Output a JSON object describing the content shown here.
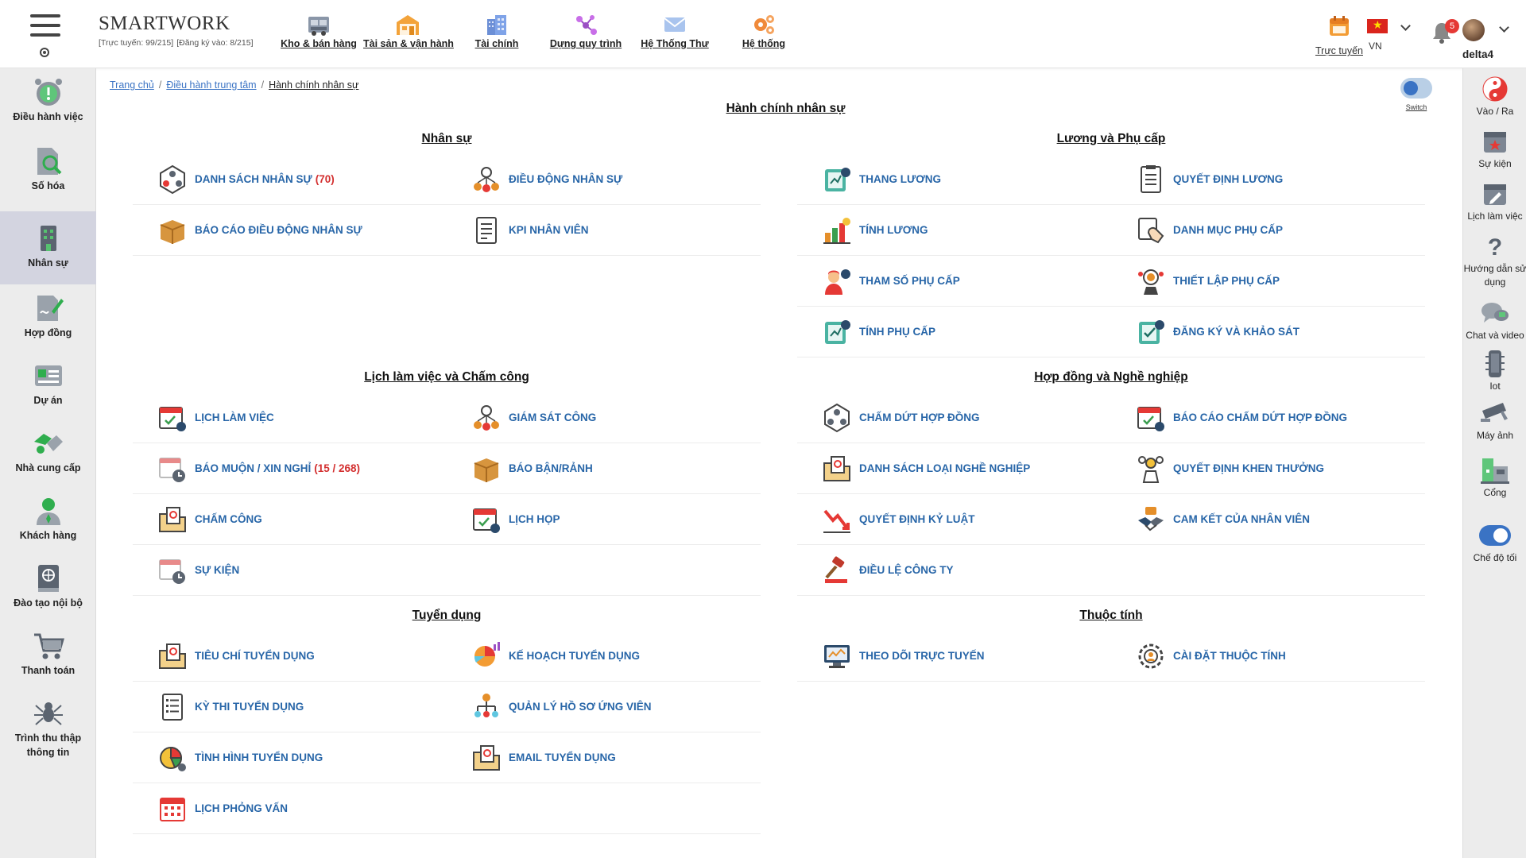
{
  "app": {
    "name": "SMARTWORK",
    "online_stats": "[Trực tuyến: 99/215]",
    "registered_stats": "[Đăng ký vào: 8/215]"
  },
  "top_nav": [
    {
      "label": "Kho & bán hàng",
      "icon": "warehouse-truck-icon"
    },
    {
      "label": "Tài sản & vận hành",
      "icon": "building-store-icon"
    },
    {
      "label": "Tài chính",
      "icon": "city-buildings-icon"
    },
    {
      "label": "Dựng quy trình",
      "icon": "workflow-nodes-icon"
    },
    {
      "label": "Hệ Thống Thư",
      "icon": "envelope-icon"
    },
    {
      "label": "Hệ thống",
      "icon": "gears-icon"
    }
  ],
  "top_right": {
    "online_label": "Trực tuyến",
    "language": "VN",
    "notification_count": "5",
    "username": "delta4"
  },
  "left_sidebar": [
    {
      "label": "Điều hành việc",
      "icon": "alarm-clock-icon"
    },
    {
      "label": "Số hóa",
      "icon": "document-search-icon"
    },
    {
      "label": "Nhân sự",
      "icon": "office-building-icon",
      "active": true
    },
    {
      "label": "Hợp đồng",
      "icon": "contract-pen-icon"
    },
    {
      "label": "Dự án",
      "icon": "project-card-icon"
    },
    {
      "label": "Nhà cung cấp",
      "icon": "supplier-handshake-icon"
    },
    {
      "label": "Khách hàng",
      "icon": "customer-person-icon"
    },
    {
      "label": "Đào tạo nội bộ",
      "icon": "training-book-icon"
    },
    {
      "label": "Thanh toán",
      "icon": "shopping-cart-icon"
    },
    {
      "label": "Trình thu thập thông tin",
      "icon": "crawler-spider-icon"
    }
  ],
  "right_sidebar": [
    {
      "label": "Vào / Ra",
      "icon": "yin-yang-icon"
    },
    {
      "label": "Sự kiện",
      "icon": "event-calendar-icon"
    },
    {
      "label": "Lịch làm việc",
      "icon": "work-calendar-icon"
    },
    {
      "label": "Hướng dẫn sử dụng",
      "icon": "help-question-icon"
    },
    {
      "label": "Chat và video",
      "icon": "chat-bubbles-icon"
    },
    {
      "label": "Iot",
      "icon": "iot-device-icon"
    },
    {
      "label": "Máy ảnh",
      "icon": "security-camera-icon"
    },
    {
      "label": "Cổng",
      "icon": "gate-door-icon"
    },
    {
      "label": "Chế độ tối",
      "icon": "toggle-icon"
    }
  ],
  "breadcrumb": {
    "home": "Trang chủ",
    "parent": "Điều hành trung tâm",
    "current": "Hành chính nhân sự"
  },
  "switch_label": "Switch",
  "page_title": "Hành chính nhân sự",
  "sections": [
    {
      "title": "Nhân sự",
      "items": [
        {
          "label": "DANH SÁCH NHÂN SỰ",
          "count": "(70)",
          "icon": "people-network-icon"
        },
        {
          "label": "ĐIỀU ĐỘNG NHÂN SỰ",
          "count": "",
          "icon": "team-transfer-icon"
        },
        {
          "label": "BÁO CÁO ĐIỀU ĐỘNG NHÂN SỰ",
          "count": "",
          "icon": "box-report-icon"
        },
        {
          "label": "KPI NHÂN VIÊN",
          "count": "",
          "icon": "kpi-document-icon"
        }
      ]
    },
    {
      "title": "Lương và Phụ cấp",
      "items": [
        {
          "label": "THANG LƯƠNG",
          "count": "",
          "icon": "salary-scale-icon"
        },
        {
          "label": "QUYẾT ĐỊNH LƯƠNG",
          "count": "",
          "icon": "decision-document-icon"
        },
        {
          "label": "TÍNH LƯƠNG",
          "count": "",
          "icon": "salary-chart-icon"
        },
        {
          "label": "DANH MỤC PHỤ CẤP",
          "count": "",
          "icon": "allowance-catalog-icon"
        },
        {
          "label": "THAM SỐ PHỤ CẤP",
          "count": "",
          "icon": "allowance-parameter-icon"
        },
        {
          "label": "THIẾT LẬP PHỤ CẤP",
          "count": "",
          "icon": "allowance-setup-icon"
        },
        {
          "label": "TÍNH PHỤ CẤP",
          "count": "",
          "icon": "allowance-calc-icon"
        },
        {
          "label": "ĐĂNG KÝ VÀ KHẢO SÁT",
          "count": "",
          "icon": "survey-register-icon"
        }
      ]
    },
    {
      "title": "Lịch làm việc và Chấm công",
      "items": [
        {
          "label": "LỊCH LÀM VIỆC",
          "count": "",
          "icon": "work-schedule-icon"
        },
        {
          "label": "GIÁM SÁT CÔNG",
          "count": "",
          "icon": "work-monitor-icon"
        },
        {
          "label": "BÁO MUỘN / XIN NGHỈ",
          "count": "(15 / 268)",
          "icon": "late-leave-calendar-icon"
        },
        {
          "label": "BÁO BẬN/RẢNH",
          "count": "",
          "icon": "busy-free-box-icon"
        },
        {
          "label": "CHẤM CÔNG",
          "count": "",
          "icon": "timekeeping-folder-icon"
        },
        {
          "label": "LỊCH HỌP",
          "count": "",
          "icon": "meeting-calendar-icon"
        },
        {
          "label": "SỰ KIỆN",
          "count": "",
          "icon": "event-clock-icon"
        }
      ]
    },
    {
      "title": "Hợp đồng và Nghề nghiệp",
      "items": [
        {
          "label": "CHẤM DỨT HỢP ĐỒNG",
          "count": "",
          "icon": "contract-terminate-icon"
        },
        {
          "label": "BÁO CÁO CHẤM DỨT HỢP ĐỒNG",
          "count": "",
          "icon": "termination-report-icon"
        },
        {
          "label": "DANH SÁCH LOẠI NGHỀ NGHIỆP",
          "count": "",
          "icon": "occupation-folder-icon"
        },
        {
          "label": "QUYẾT ĐỊNH KHEN THƯỞNG",
          "count": "",
          "icon": "reward-decision-icon"
        },
        {
          "label": "QUYẾT ĐỊNH KỶ LUẬT",
          "count": "",
          "icon": "discipline-chart-icon"
        },
        {
          "label": "CAM KẾT CỦA NHÂN VIÊN",
          "count": "",
          "icon": "commitment-handshake-icon"
        },
        {
          "label": "ĐIỀU LỆ CÔNG TY",
          "count": "",
          "icon": "gavel-icon"
        }
      ]
    },
    {
      "title": "Tuyển dụng",
      "items": [
        {
          "label": "TIÊU CHÍ TUYỂN DỤNG",
          "count": "",
          "icon": "criteria-folder-icon"
        },
        {
          "label": "KẾ HOẠCH TUYỂN DỤNG",
          "count": "",
          "icon": "plan-pie-chart-icon"
        },
        {
          "label": "KỲ THI TUYỂN DỤNG",
          "count": "",
          "icon": "exam-list-icon"
        },
        {
          "label": "QUẢN LÝ HỒ SƠ ỨNG VIÊN",
          "count": "",
          "icon": "candidate-tree-icon"
        },
        {
          "label": "TÌNH HÌNH TUYỂN DỤNG",
          "count": "",
          "icon": "status-pie-icon"
        },
        {
          "label": "EMAIL TUYỂN DỤNG",
          "count": "",
          "icon": "email-folder-icon"
        },
        {
          "label": "LỊCH PHỎNG VẤN",
          "count": "",
          "icon": "interview-calendar-icon"
        }
      ]
    },
    {
      "title": "Thuộc tính",
      "items": [
        {
          "label": "THEO DÕI TRỰC TUYẾN",
          "count": "",
          "icon": "online-tracking-icon"
        },
        {
          "label": "CÀI ĐẶT THUỘC TÍNH",
          "count": "",
          "icon": "attribute-settings-icon"
        }
      ]
    }
  ],
  "colors": {
    "link": "#2866a8",
    "count": "#d32f2f",
    "sidebar_bg": "#ececec",
    "sidebar_active": "#d3d4e0",
    "toggle": "#3a73c4"
  }
}
